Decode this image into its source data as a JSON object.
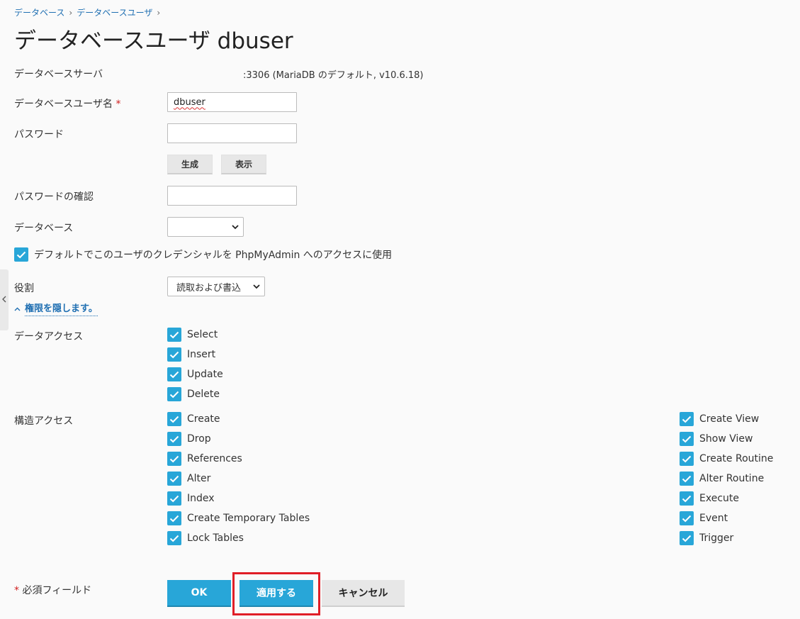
{
  "breadcrumb": {
    "item1": "データベース",
    "item2": "データベースユーザ"
  },
  "page_title": "データベースユーザ dbuser",
  "form": {
    "db_server_label": "データベースサーバ",
    "db_server_value": ":3306 (MariaDB のデフォルト, v10.6.18)",
    "username_label": "データベースユーザ名",
    "required_mark": "*",
    "username_value": "dbuser",
    "password_label": "パスワード",
    "password_value": "",
    "generate_label": "生成",
    "show_label": "表示",
    "confirm_label": "パスワードの確認",
    "confirm_value": "",
    "database_label": "データベース",
    "database_value": "",
    "phpmyadmin_label": "デフォルトでこのユーザのクレデンシャルを PhpMyAdmin へのアクセスに使用",
    "phpmyadmin_checked": true,
    "role_label": "役割",
    "role_value": "読取および書込",
    "toggle_label": "権限を隠します。"
  },
  "data_access": {
    "label": "データアクセス",
    "items": [
      "Select",
      "Insert",
      "Update",
      "Delete"
    ]
  },
  "structure_access": {
    "label": "構造アクセス",
    "col1": [
      "Create",
      "Drop",
      "References",
      "Alter",
      "Index",
      "Create Temporary Tables",
      "Lock Tables"
    ],
    "col2": [
      "Create View",
      "Show View",
      "Create Routine",
      "Alter Routine",
      "Execute",
      "Event",
      "Trigger"
    ]
  },
  "footer": {
    "required_note": "必須フィールド",
    "ok_label": "OK",
    "apply_label": "適用する",
    "cancel_label": "キャンセル"
  },
  "colors": {
    "accent": "#28a6d8",
    "link": "#1f6fb2",
    "highlight": "#e01e27"
  }
}
